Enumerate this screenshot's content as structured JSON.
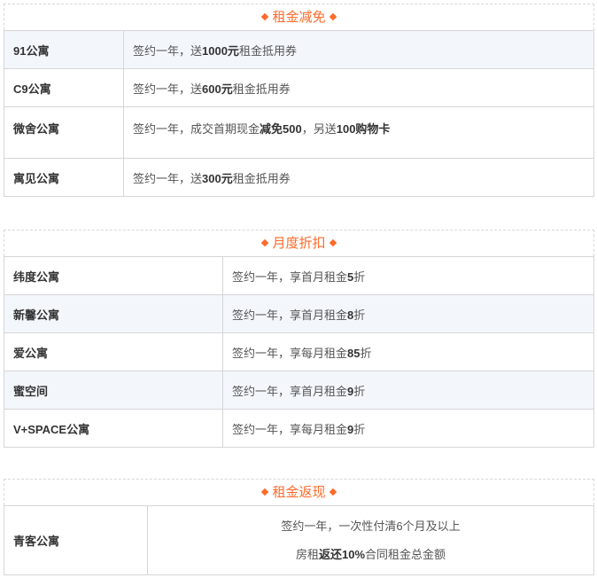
{
  "sections": [
    {
      "title": "租金减免",
      "rows": [
        {
          "name": "91公寓",
          "desc": [
            "签约一年，送",
            "1000元",
            "租金抵用券"
          ]
        },
        {
          "name": "C9公寓",
          "desc": [
            "签约一年，送",
            "600元",
            "租金抵用券"
          ]
        },
        {
          "name": "微舍公寓",
          "desc": [
            "签约一年，成交首期现金",
            "减免500",
            "，另送",
            "100购物卡"
          ]
        },
        {
          "name": "寓见公寓",
          "desc": [
            "签约一年，送",
            "300元",
            "租金抵用券"
          ]
        }
      ]
    },
    {
      "title": "月度折扣",
      "rows": [
        {
          "name": "纬度公寓",
          "desc": [
            "签约一年，享首月租金",
            "5",
            "折"
          ]
        },
        {
          "name": "新馨公寓",
          "desc": [
            "签约一年，享首月租金",
            "8",
            "折"
          ]
        },
        {
          "name": "爱公寓",
          "desc": [
            "签约一年，享每月租金",
            "85",
            "折"
          ]
        },
        {
          "name": "蜜空间",
          "desc": [
            "签约一年，享首月租金",
            "9",
            "折"
          ]
        },
        {
          "name": "V+SPACE公寓",
          "desc": [
            "签约一年，享每月租金",
            "9",
            "折"
          ]
        }
      ]
    },
    {
      "title": "租金返现",
      "rows": [
        {
          "name": "青客公寓",
          "line1": "签约一年，一次性付清6个月及以上",
          "line2": [
            "房租",
            "返还10%",
            "合同租金总金额"
          ]
        }
      ]
    }
  ]
}
